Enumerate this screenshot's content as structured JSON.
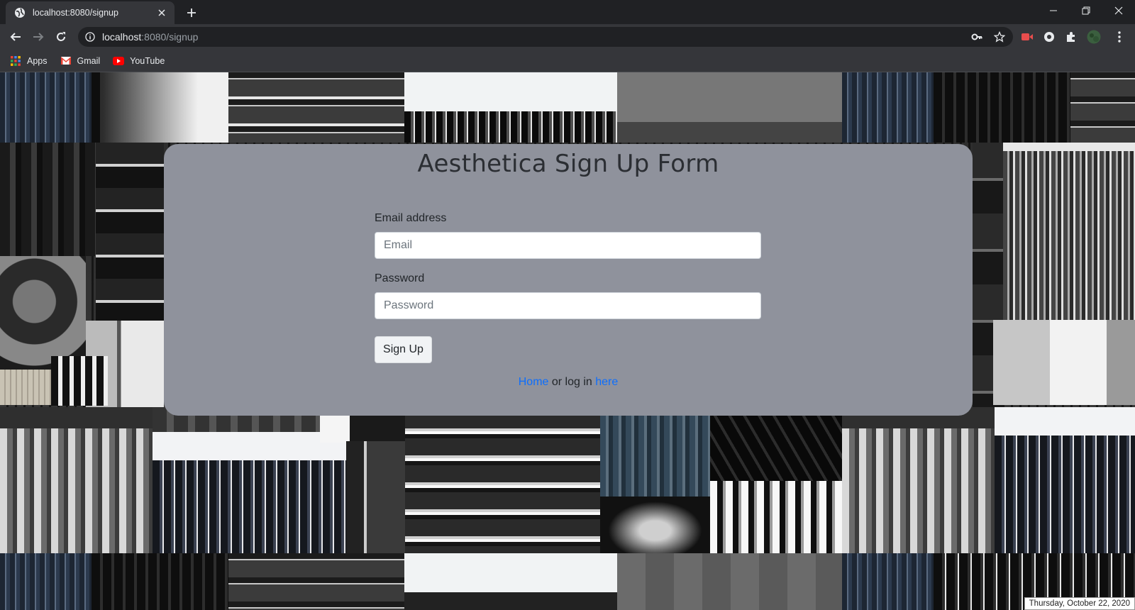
{
  "browser": {
    "tab": {
      "title": "localhost:8080/signup",
      "favicon": "globe-icon"
    },
    "window_controls": [
      "minimize-icon",
      "restore-icon",
      "close-icon"
    ],
    "address_bar": {
      "host": "localhost",
      "path": ":8080/signup"
    },
    "bookmarks": [
      {
        "label": "Apps",
        "icon": "apps-grid-icon"
      },
      {
        "label": "Gmail",
        "icon": "gmail-icon"
      },
      {
        "label": "YouTube",
        "icon": "youtube-icon"
      }
    ]
  },
  "page": {
    "title": "Aesthetica Sign Up Form",
    "email": {
      "label": "Email address",
      "placeholder": "Email",
      "value": ""
    },
    "password": {
      "label": "Password",
      "placeholder": "Password",
      "value": ""
    },
    "submit_label": "Sign Up",
    "footer": {
      "home_link": "Home",
      "middle_text": " or log in ",
      "login_link": "here"
    }
  },
  "taskbar_date": "Thursday, October 22, 2020",
  "colors": {
    "card_background": "#8f929c",
    "link": "#0d6efd",
    "chrome_dark": "#202124",
    "chrome_toolbar": "#35363a"
  }
}
